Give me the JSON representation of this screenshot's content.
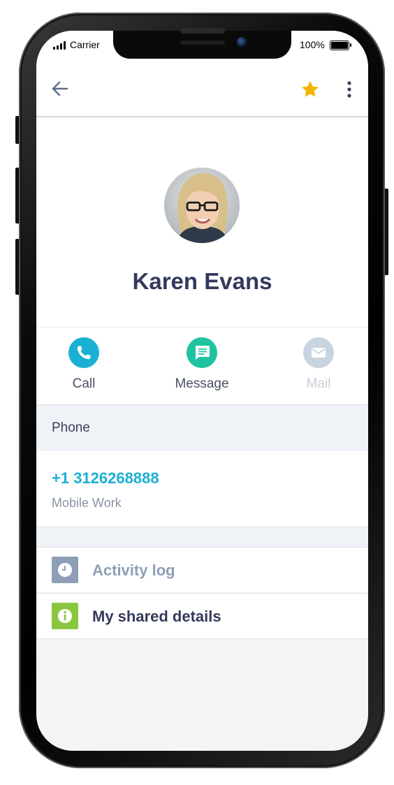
{
  "status_bar": {
    "carrier": "Carrier",
    "battery": "100%"
  },
  "app_bar": {
    "back_icon": "arrow-left",
    "favorite_icon": "star",
    "menu_icon": "more-vertical",
    "favorite_color": "#f5b301"
  },
  "contact": {
    "name": "Karen Evans",
    "avatar": "person-photo"
  },
  "actions": [
    {
      "label": "Call",
      "icon": "phone-icon",
      "color": "#1ab0d4",
      "enabled": true
    },
    {
      "label": "Message",
      "icon": "message-icon",
      "color": "#20c3a1",
      "enabled": true
    },
    {
      "label": "Mail",
      "icon": "mail-icon",
      "color": "#c8d4e0",
      "enabled": false
    }
  ],
  "phone_section": {
    "title": "Phone",
    "number": "+1 3126268888",
    "type": "Mobile Work"
  },
  "list": [
    {
      "label": "Activity log",
      "icon": "clock-icon",
      "color": "#8e9fb5",
      "enabled": false
    },
    {
      "label": "My shared details",
      "icon": "info-icon",
      "color": "#8cc63f",
      "enabled": true
    }
  ]
}
